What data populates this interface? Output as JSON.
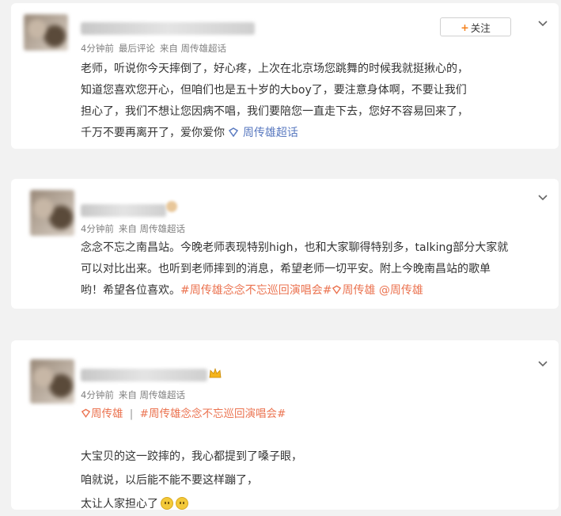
{
  "posts": [
    {
      "meta": {
        "time": "4分钟前",
        "tag": "最后评论",
        "source": "来自 周传雄超话"
      },
      "follow_label": "关注",
      "follow_plus": "+",
      "lines": [
        "老师，听说你今天摔倒了，好心疼，上次在北京场您跳舞的时候我就挺揪心的，",
        "知道您喜欢您开心，但咱们也是五十岁的大boy了，要注意身体啊，不要让我们",
        "担心了，我们不想让您因病不唱，我们要陪您一直走下去，您好不容易回来了，",
        "千万不要再离开了，爱你爱你 "
      ],
      "topic_link": "周传雄超话"
    },
    {
      "meta": {
        "time": "4分钟前",
        "source": "来自 周传雄超话"
      },
      "lines": [
        "念念不忘之南昌站。今晚老师表现特别high，也和大家聊得特别多，talking部分大家就",
        "可以对比出来。也听到老师摔到的消息，希望老师一切平安。附上今晚南昌站的歌单",
        "哟！希望各位喜欢。"
      ],
      "hashtag": "#周传雄念念不忘巡回演唱会#",
      "topic_link": "周传雄",
      "mention": "@周传雄"
    },
    {
      "meta": {
        "time": "4分钟前",
        "source": "来自 周传雄超话"
      },
      "topic_link": "周传雄",
      "separator": "|",
      "hashtag": "#周传雄念念不忘巡回演唱会#",
      "lines": [
        "大宝贝的这一跤摔的，我心都提到了嗓子眼，",
        "咱就说，以后能不能不要这样蹦了，",
        "太让人家担心了"
      ]
    }
  ],
  "colors": {
    "link": "#eb7350",
    "topic": "#5a7ac0",
    "follow_plus": "#f5801a"
  },
  "icons": [
    "chevron-down-icon",
    "super-topic-icon",
    "crown-icon",
    "crying-emoji-icon"
  ]
}
